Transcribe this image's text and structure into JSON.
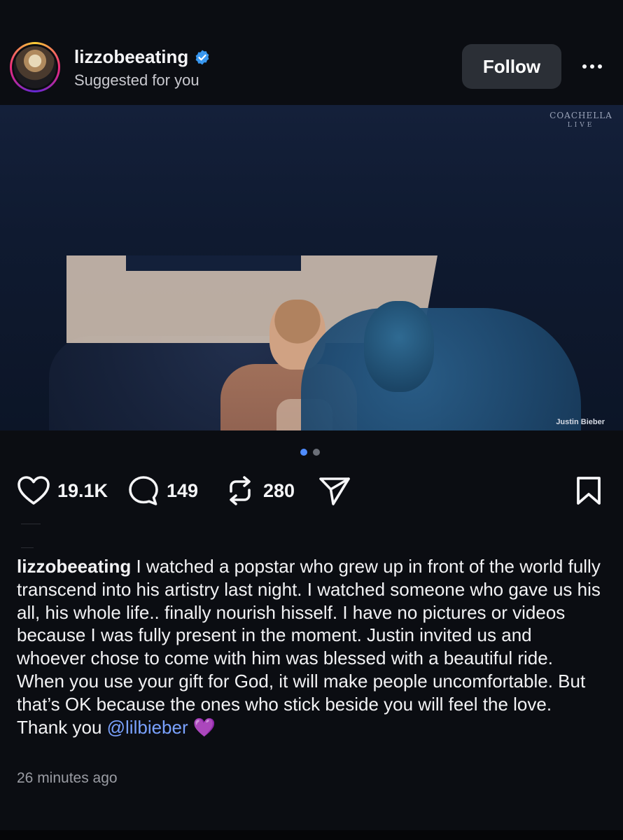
{
  "post": {
    "username": "lizzobeeating",
    "subtitle": "Suggested for you",
    "follow_label": "Follow",
    "more_label": "More options",
    "media": {
      "watermark_top": "COACHELLA",
      "watermark_bottom": "LIVE",
      "caption_tag": "Justin Bieber",
      "carousel_count": 2,
      "carousel_active": 1
    },
    "stats": {
      "likes": "19.1K",
      "comments": "149",
      "reposts": "280"
    },
    "caption": {
      "user": "lizzobeeating",
      "text": " I watched a popstar who grew up in front of the world fully transcend into his artistry last night. I watched someone who gave us his all, his whole life.. finally nourish hisself. I have no pictures or videos because I was fully present in the moment. Justin invited us and whoever chose to come with him was blessed with a beautiful ride. When you use your gift for God, it will make people uncomfortable. But that’s OK because the ones who stick beside you will feel the love. Thank you ",
      "mention": "@lilbieber",
      "emoji": "💜"
    },
    "timestamp": "26 minutes ago"
  },
  "colors": {
    "background": "#0b0d12",
    "accent": "#4f8cff",
    "mention": "#7aa2ff",
    "verified": "#3897f0",
    "follow_button": "#2b2f36"
  },
  "icons": [
    "verified-badge-icon",
    "more-dots-icon",
    "heart-icon",
    "comment-icon",
    "repost-icon",
    "share-icon",
    "bookmark-icon"
  ]
}
